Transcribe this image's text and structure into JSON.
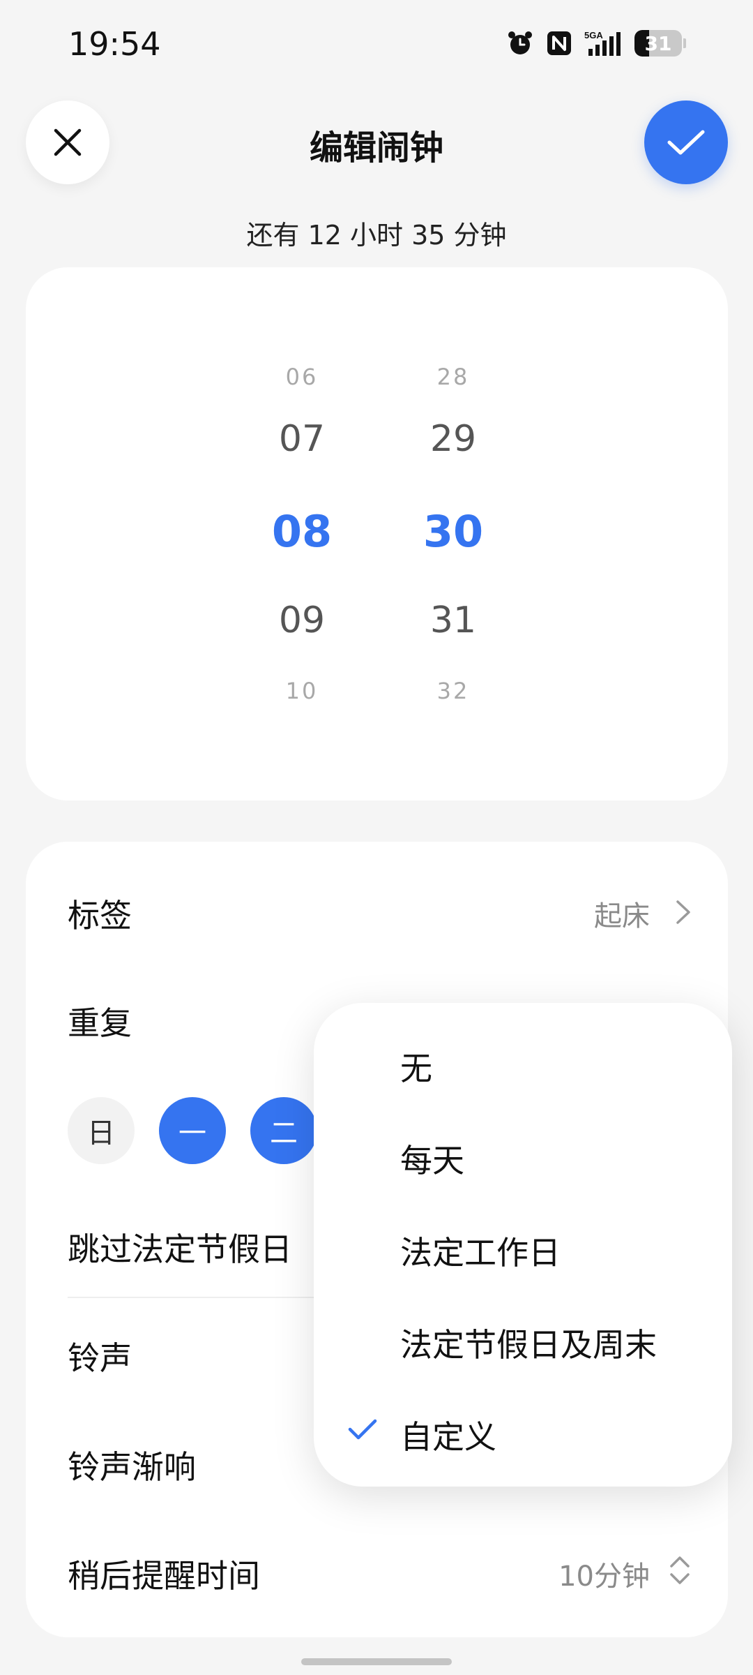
{
  "status_bar": {
    "time": "19:54",
    "network_label": "5GA",
    "battery_level": "31",
    "battery_fraction": 0.31,
    "icons": [
      "alarm-icon",
      "nfc-icon",
      "signal-icon",
      "battery-icon"
    ]
  },
  "header": {
    "title": "编辑闹钟",
    "close_icon": "close-icon",
    "confirm_icon": "check-icon"
  },
  "remaining": "还有 12 小时 35 分钟",
  "picker": {
    "hours": [
      "06",
      "07",
      "08",
      "09",
      "10"
    ],
    "minutes": [
      "28",
      "29",
      "30",
      "31",
      "32"
    ],
    "selected_hour": "08",
    "selected_minute": "30"
  },
  "settings": {
    "label": {
      "title": "标签",
      "value": "起床"
    },
    "repeat": {
      "title": "重复"
    },
    "days": [
      {
        "label": "日",
        "selected": false
      },
      {
        "label": "一",
        "selected": true
      },
      {
        "label": "二",
        "selected": true
      }
    ],
    "skip_holidays": {
      "title": "跳过法定节假日"
    },
    "ringtone": {
      "title": "铃声"
    },
    "fade_in": {
      "title": "铃声渐响"
    },
    "snooze": {
      "title": "稍后提醒时间",
      "value": "10分钟"
    }
  },
  "repeat_menu": {
    "options": [
      "无",
      "每天",
      "法定工作日",
      "法定节假日及周末",
      "自定义"
    ],
    "selected": "自定义"
  },
  "colors": {
    "accent": "#3574f0",
    "background": "#f5f5f5",
    "card": "#ffffff"
  }
}
